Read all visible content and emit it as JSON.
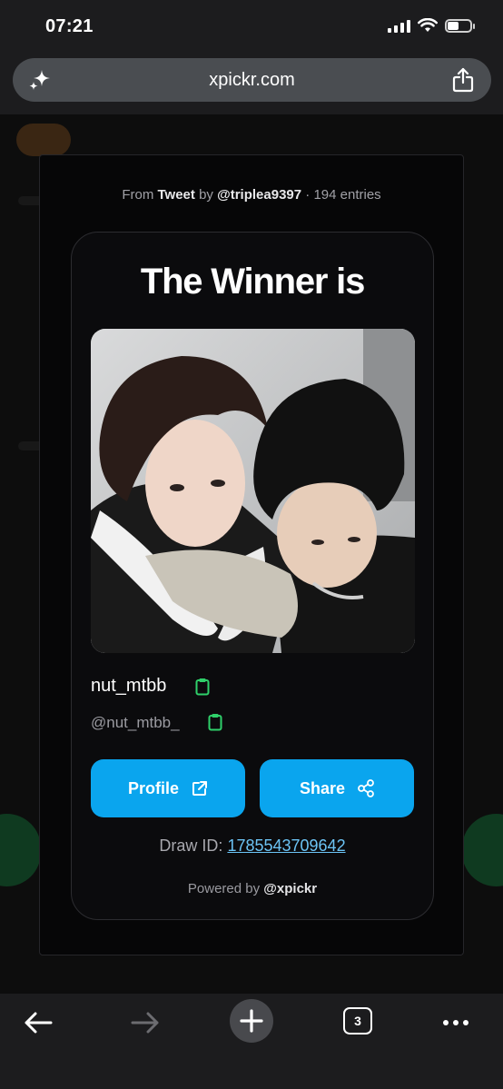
{
  "status_bar": {
    "time": "07:21"
  },
  "browser": {
    "url": "xpickr.com"
  },
  "modal": {
    "source_prefix": "From",
    "source_type": "Tweet",
    "source_by": "by",
    "source_user": "@triplea9397",
    "source_entries": "· 194 entries",
    "title": "The Winner is",
    "winner_name": "nut_mtbb",
    "winner_handle": "@nut_mtbb_",
    "profile_label": "Profile",
    "share_label": "Share",
    "draw_id_label": "Draw ID:",
    "draw_id_value": "1785543709642",
    "powered_by_label": "Powered by",
    "powered_by_brand": "@xpickr"
  },
  "toolbar": {
    "tab_count": "3"
  },
  "colors": {
    "accent": "#0aa5ee",
    "copy_icon": "#2fd06a",
    "link": "#6cc4f5",
    "card_bg": "#0b0b0d"
  },
  "icons": [
    "sparkle-icon",
    "share-icon",
    "copy-icon",
    "external-link-icon",
    "share-nodes-icon",
    "back-arrow-icon",
    "forward-arrow-icon",
    "plus-icon",
    "more-dots-icon",
    "wifi-icon",
    "signal-icon",
    "battery-icon"
  ]
}
